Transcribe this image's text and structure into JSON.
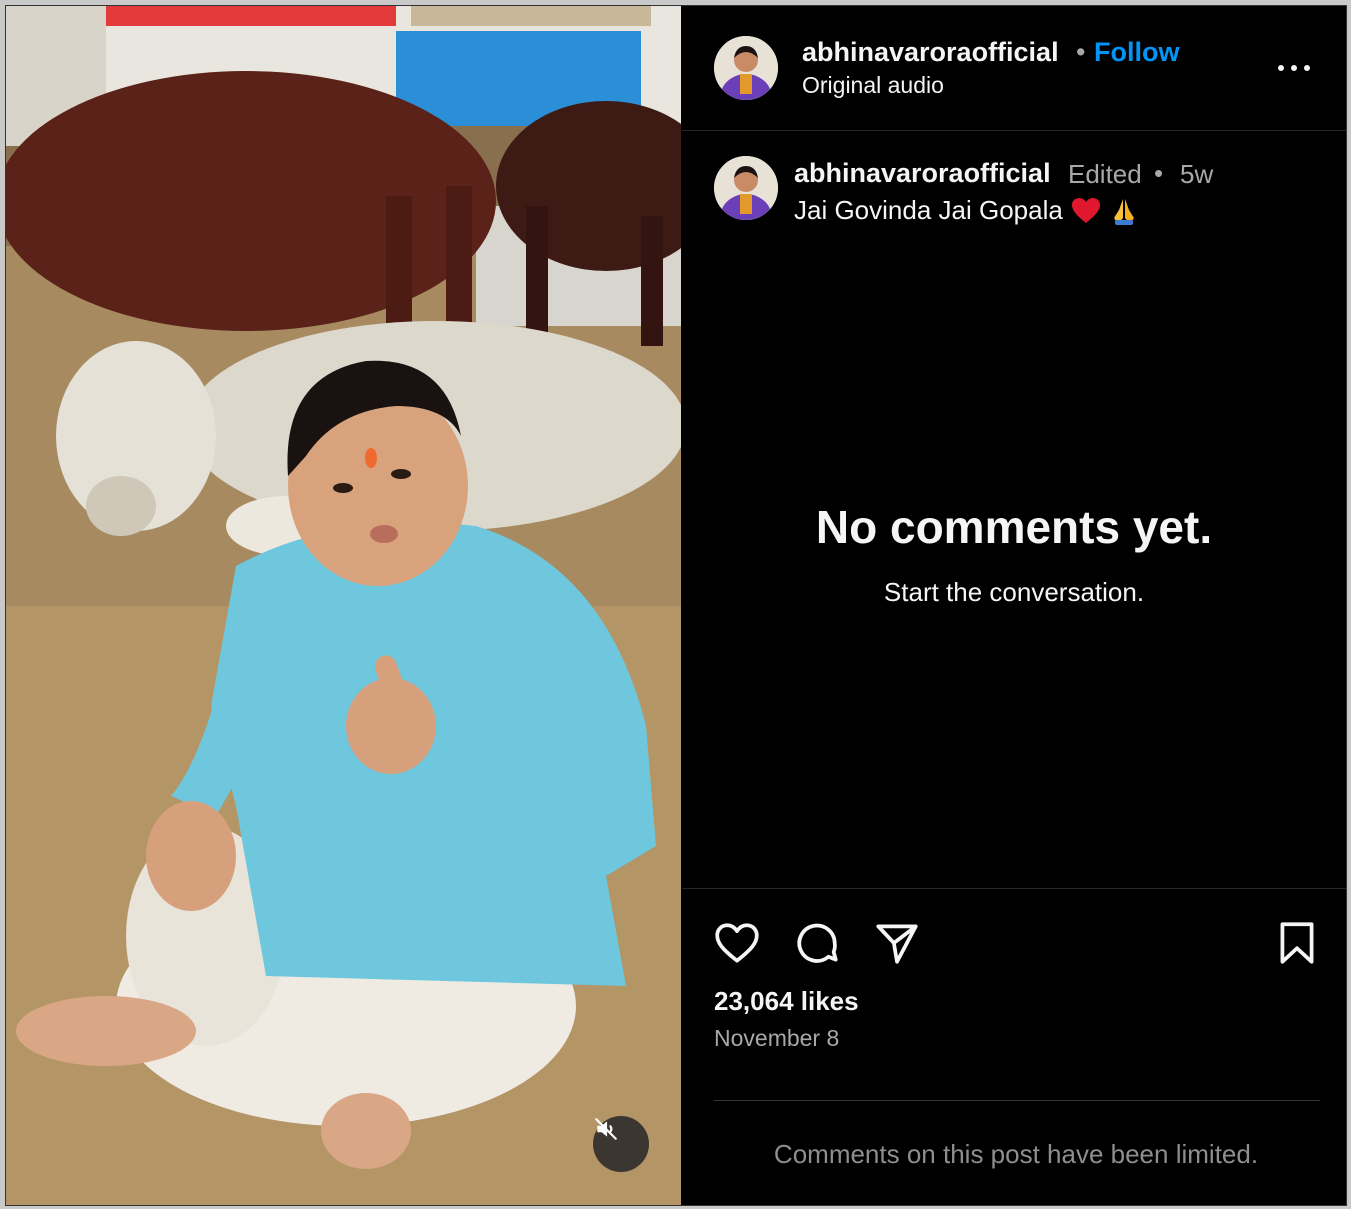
{
  "post": {
    "username": "abhinavaroraofficial",
    "follow_label": "Follow",
    "separator": "•",
    "audio": "Original audio"
  },
  "caption": {
    "username": "abhinavaroraofficial",
    "edited": "Edited",
    "separator": "•",
    "time": "5w",
    "text": "Jai Govinda Jai Gopala"
  },
  "comments": {
    "empty_title": "No comments yet.",
    "empty_subtitle": "Start the conversation."
  },
  "stats": {
    "likes": "23,064 likes",
    "date": "November 8"
  },
  "footer": {
    "limited_notice": "Comments on this post have been limited."
  },
  "icons": {
    "more": "more-options-icon",
    "like": "heart-icon",
    "comment": "comment-bubble-icon",
    "share": "send-icon",
    "save": "bookmark-icon",
    "mute": "speaker-muted-icon"
  },
  "colors": {
    "background": "#000000",
    "text": "#f5f5f5",
    "muted_text": "#a8a8a8",
    "link_blue": "#0095f6",
    "divider": "#262626"
  }
}
